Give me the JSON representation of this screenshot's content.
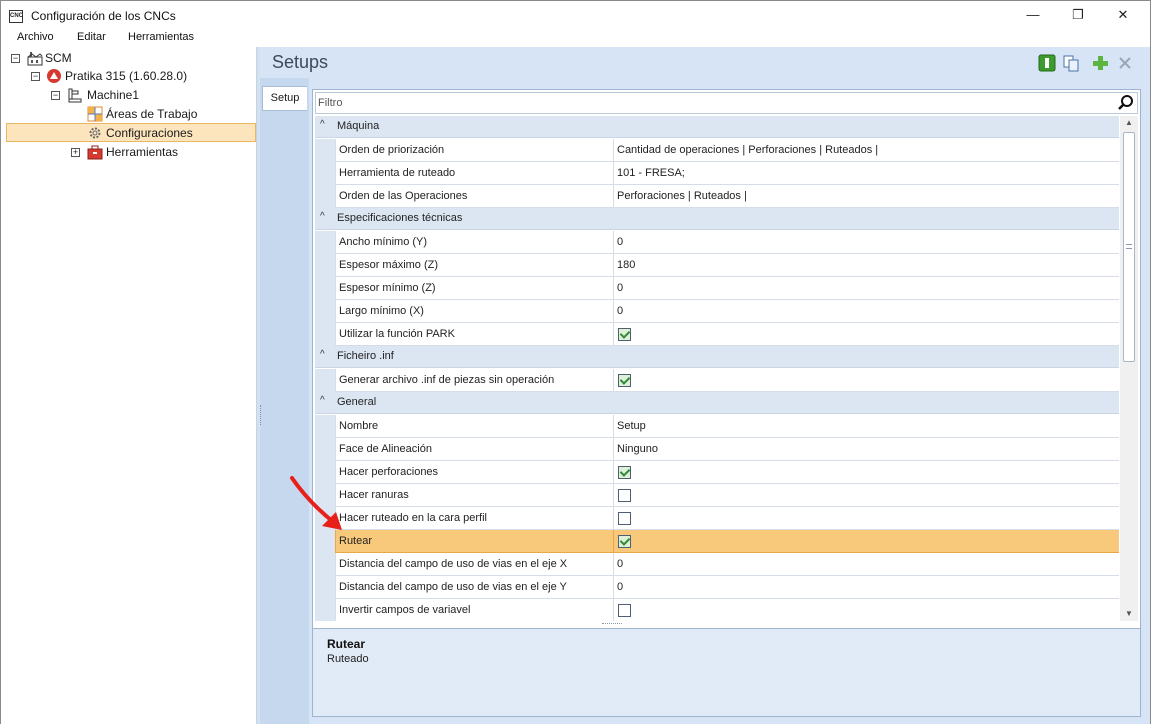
{
  "window": {
    "app_icon_text": "CNC",
    "title": "Configuración de los CNCs",
    "minimize_glyph": "—",
    "maximize_glyph": "❐",
    "close_glyph": "✕"
  },
  "menu": [
    "Archivo",
    "Editar",
    "Herramientas"
  ],
  "tree": {
    "root": "SCM",
    "child": "Pratika 315 (1.60.28.0)",
    "machine": "Machine1",
    "items": [
      "Áreas de Trabajo",
      "Configuraciones",
      "Herramientas"
    ],
    "selected": "Configuraciones",
    "expand_minus": "−",
    "expand_plus": "+"
  },
  "panel": {
    "title": "Setups",
    "vtab": "Setup",
    "filter_placeholder": "Filtro",
    "toolbar_icons": [
      "green-block-icon",
      "copy-icon",
      "add-icon",
      "delete-icon"
    ]
  },
  "grid": {
    "categories": [
      {
        "label": "Máquina",
        "rows": [
          {
            "name": "Orden de priorización",
            "value": "Cantidad de operaciones | Perforaciones | Ruteados |"
          },
          {
            "name": "Herramienta de ruteado",
            "value": "101 - FRESA;"
          },
          {
            "name": "Orden de las Operaciones",
            "value": "Perforaciones | Ruteados |"
          }
        ]
      },
      {
        "label": "Especificaciones técnicas",
        "rows": [
          {
            "name": "Ancho mínimo (Y)",
            "value": "0"
          },
          {
            "name": "Espesor máximo (Z)",
            "value": "180"
          },
          {
            "name": "Espesor mínimo (Z)",
            "value": "0"
          },
          {
            "name": "Largo mínimo (X)",
            "value": "0"
          },
          {
            "name": "Utilizar la función PARK",
            "checkbox": true
          }
        ]
      },
      {
        "label": "Ficheiro .inf",
        "rows": [
          {
            "name": "Generar archivo .inf de piezas sin operación",
            "checkbox": true
          }
        ]
      },
      {
        "label": "General",
        "rows": [
          {
            "name": "Nombre",
            "value": "Setup"
          },
          {
            "name": "Face de Alineación",
            "value": "Ninguno"
          },
          {
            "name": "Hacer perforaciones",
            "checkbox": true
          },
          {
            "name": "Hacer ranuras",
            "checkbox": false
          },
          {
            "name": "Hacer ruteado en la cara perfil",
            "checkbox": false
          },
          {
            "name": "Rutear",
            "checkbox": true,
            "highlighted": true
          },
          {
            "name": "Distancia del campo de uso de vias en el eje X",
            "value": "0"
          },
          {
            "name": "Distancia del campo de uso de vias en el eje Y",
            "value": "0"
          },
          {
            "name": "Invertir campos de variavel",
            "checkbox": false
          }
        ]
      }
    ]
  },
  "description": {
    "title": "Rutear",
    "text": "Ruteado"
  },
  "colors": {
    "highlight": "#f8c97a",
    "panel_bg": "#d6e4f5",
    "annotation_arrow": "#e8201a"
  }
}
